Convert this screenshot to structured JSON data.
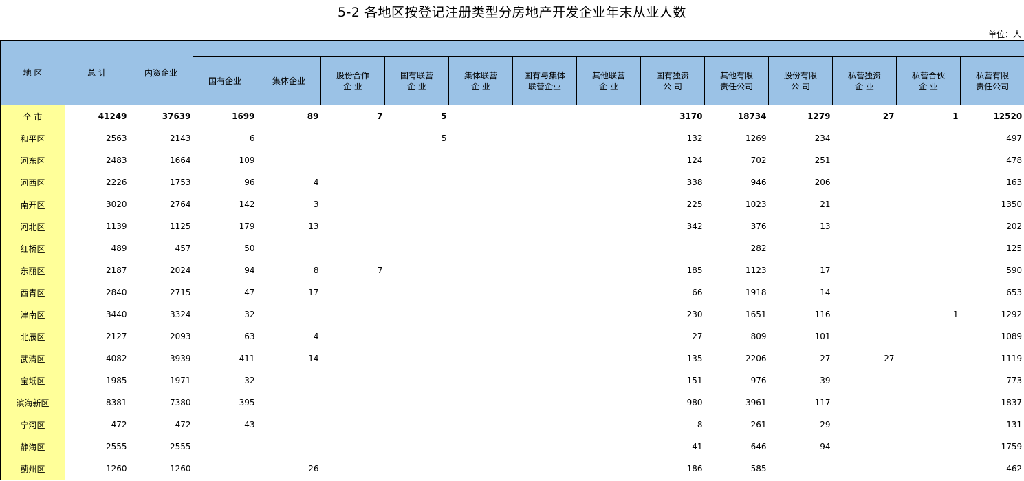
{
  "title": "5-2   各地区按登记注册类型分房地产开发企业年末从业人数",
  "unit": "单位：人",
  "headers": {
    "region": "地  区",
    "total": "总  计",
    "domestic": "内资企业",
    "sub": [
      "国有企业",
      "集体企业",
      "股份合作\n企  业",
      "国有联营\n企  业",
      "集体联营\n企  业",
      "国有与集体\n联营企业",
      "其他联营\n企  业",
      "国有独资\n公  司",
      "其他有限\n责任公司",
      "股份有限\n公  司",
      "私营独资\n企  业",
      "私营合伙\n企  业",
      "私营有限\n责任公司"
    ]
  },
  "rows": [
    {
      "region": "全  市",
      "cells": [
        "41249",
        "37639",
        "1699",
        "89",
        "7",
        "5",
        "",
        "",
        "",
        "3170",
        "18734",
        "1279",
        "27",
        "1",
        "12520"
      ]
    },
    {
      "region": "和平区",
      "cells": [
        "2563",
        "2143",
        "6",
        "",
        "",
        "5",
        "",
        "",
        "",
        "132",
        "1269",
        "234",
        "",
        "",
        "497"
      ]
    },
    {
      "region": "河东区",
      "cells": [
        "2483",
        "1664",
        "109",
        "",
        "",
        "",
        "",
        "",
        "",
        "124",
        "702",
        "251",
        "",
        "",
        "478"
      ]
    },
    {
      "region": "河西区",
      "cells": [
        "2226",
        "1753",
        "96",
        "4",
        "",
        "",
        "",
        "",
        "",
        "338",
        "946",
        "206",
        "",
        "",
        "163"
      ]
    },
    {
      "region": "南开区",
      "cells": [
        "3020",
        "2764",
        "142",
        "3",
        "",
        "",
        "",
        "",
        "",
        "225",
        "1023",
        "21",
        "",
        "",
        "1350"
      ]
    },
    {
      "region": "河北区",
      "cells": [
        "1139",
        "1125",
        "179",
        "13",
        "",
        "",
        "",
        "",
        "",
        "342",
        "376",
        "13",
        "",
        "",
        "202"
      ]
    },
    {
      "region": "红桥区",
      "cells": [
        "489",
        "457",
        "50",
        "",
        "",
        "",
        "",
        "",
        "",
        "",
        "282",
        "",
        "",
        "",
        "125"
      ]
    },
    {
      "region": "东丽区",
      "cells": [
        "2187",
        "2024",
        "94",
        "8",
        "7",
        "",
        "",
        "",
        "",
        "185",
        "1123",
        "17",
        "",
        "",
        "590"
      ]
    },
    {
      "region": "西青区",
      "cells": [
        "2840",
        "2715",
        "47",
        "17",
        "",
        "",
        "",
        "",
        "",
        "66",
        "1918",
        "14",
        "",
        "",
        "653"
      ]
    },
    {
      "region": "津南区",
      "cells": [
        "3440",
        "3324",
        "32",
        "",
        "",
        "",
        "",
        "",
        "",
        "230",
        "1651",
        "116",
        "",
        "1",
        "1292"
      ]
    },
    {
      "region": "北辰区",
      "cells": [
        "2127",
        "2093",
        "63",
        "4",
        "",
        "",
        "",
        "",
        "",
        "27",
        "809",
        "101",
        "",
        "",
        "1089"
      ]
    },
    {
      "region": "武清区",
      "cells": [
        "4082",
        "3939",
        "411",
        "14",
        "",
        "",
        "",
        "",
        "",
        "135",
        "2206",
        "27",
        "27",
        "",
        "1119"
      ]
    },
    {
      "region": "宝坻区",
      "cells": [
        "1985",
        "1971",
        "32",
        "",
        "",
        "",
        "",
        "",
        "",
        "151",
        "976",
        "39",
        "",
        "",
        "773"
      ]
    },
    {
      "region": "滨海新区",
      "cells": [
        "8381",
        "7380",
        "395",
        "",
        "",
        "",
        "",
        "",
        "",
        "980",
        "3961",
        "117",
        "",
        "",
        "1837"
      ]
    },
    {
      "region": "宁河区",
      "cells": [
        "472",
        "472",
        "43",
        "",
        "",
        "",
        "",
        "",
        "",
        "8",
        "261",
        "29",
        "",
        "",
        "131"
      ]
    },
    {
      "region": "静海区",
      "cells": [
        "2555",
        "2555",
        "",
        "",
        "",
        "",
        "",
        "",
        "",
        "41",
        "646",
        "94",
        "",
        "",
        "1759"
      ]
    },
    {
      "region": "蓟州区",
      "cells": [
        "1260",
        "1260",
        "",
        "26",
        "",
        "",
        "",
        "",
        "",
        "186",
        "585",
        "",
        "",
        "",
        "462"
      ]
    }
  ]
}
